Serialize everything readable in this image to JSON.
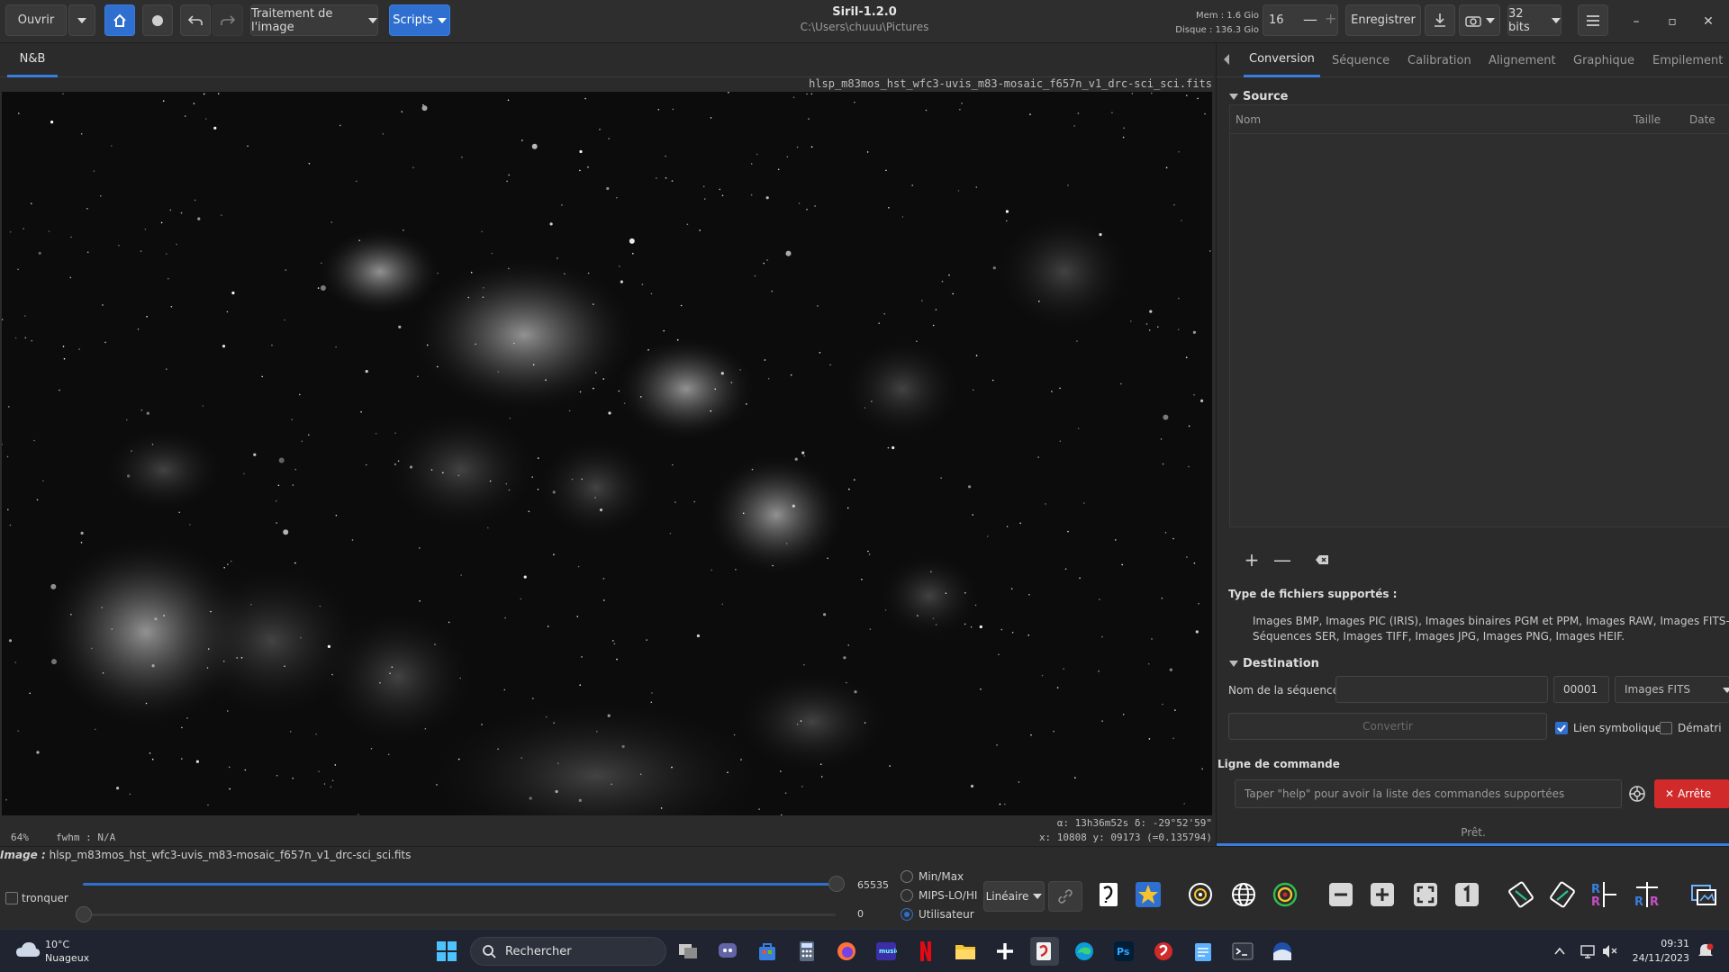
{
  "header": {
    "open_label": "Ouvrir",
    "processing_label": "Traitement de l'image",
    "scripts_label": "Scripts",
    "title": "Siril-1.2.0",
    "subtitle": "C:\\Users\\chuuu\\Pictures",
    "mem": "Mem : 1.6 Gio",
    "disk": "Disque : 136.3 Gio",
    "threads_value": "16",
    "save_label": "Enregistrer",
    "bitdepth_label": "32 bits"
  },
  "image_tabs": {
    "active": "N&B"
  },
  "canvas": {
    "filename": "hlsp_m83mos_hst_wfc3-uvis_m83-mosaic_f657n_v1_drc-sci_sci.fits",
    "zoom": "64%",
    "fwhm": "fwhm : N/A",
    "coords_ra_dec": "α: 13h36m52s δ: -29°52'59\"",
    "coords_xy": "x: 10808 y: 09173 (=0.135794)"
  },
  "right_panel": {
    "tabs": [
      "Conversion",
      "Séquence",
      "Calibration",
      "Alignement",
      "Graphique",
      "Empilement"
    ],
    "active_tab": "Conversion",
    "source_title": "Source",
    "columns": {
      "name": "Nom",
      "size": "Taille",
      "date": "Date"
    },
    "types_title": "Type de fichiers supportés :",
    "types_line1": "Images BMP, Images PIC (IRIS), Images binaires PGM et PPM, Images RAW, Images FITS-CFA, Films",
    "types_line2": "Séquences SER, Images TIFF, Images JPG, Images PNG, Images HEIF.",
    "destination_title": "Destination",
    "seq_name_label": "Nom de la séquence :",
    "seq_start": "00001",
    "output_format": "Images FITS",
    "convert_label": "Convertir",
    "symlink_label": "Lien symbolique",
    "demosaic_label": "Dématri",
    "cmd_title": "Ligne de commande",
    "cmd_placeholder": "Taper \"help\" pour avoir la liste des commandes supportées",
    "stop_label": "Arrête",
    "status": "Prêt."
  },
  "bottom": {
    "image_label": "Image :",
    "image_name": "hlsp_m83mos_hst_wfc3-uvis_m83-mosaic_f657n_v1_drc-sci_sci.fits",
    "clip_label": "tronquer",
    "high_value": "65535",
    "low_value": "0",
    "modes": [
      "Min/Max",
      "MIPS-LO/HI",
      "Utilisateur"
    ],
    "selected_mode": "Utilisateur",
    "stretch_label": "Linéaire"
  },
  "taskbar": {
    "weather_temp": "10°C",
    "weather_desc": "Nuageux",
    "search_label": "Rechercher",
    "time": "09:31",
    "date": "24/11/2023"
  },
  "colors": {
    "accent": "#2f6fcf",
    "stop": "#d12a2a",
    "bg": "#2b2b2b"
  }
}
